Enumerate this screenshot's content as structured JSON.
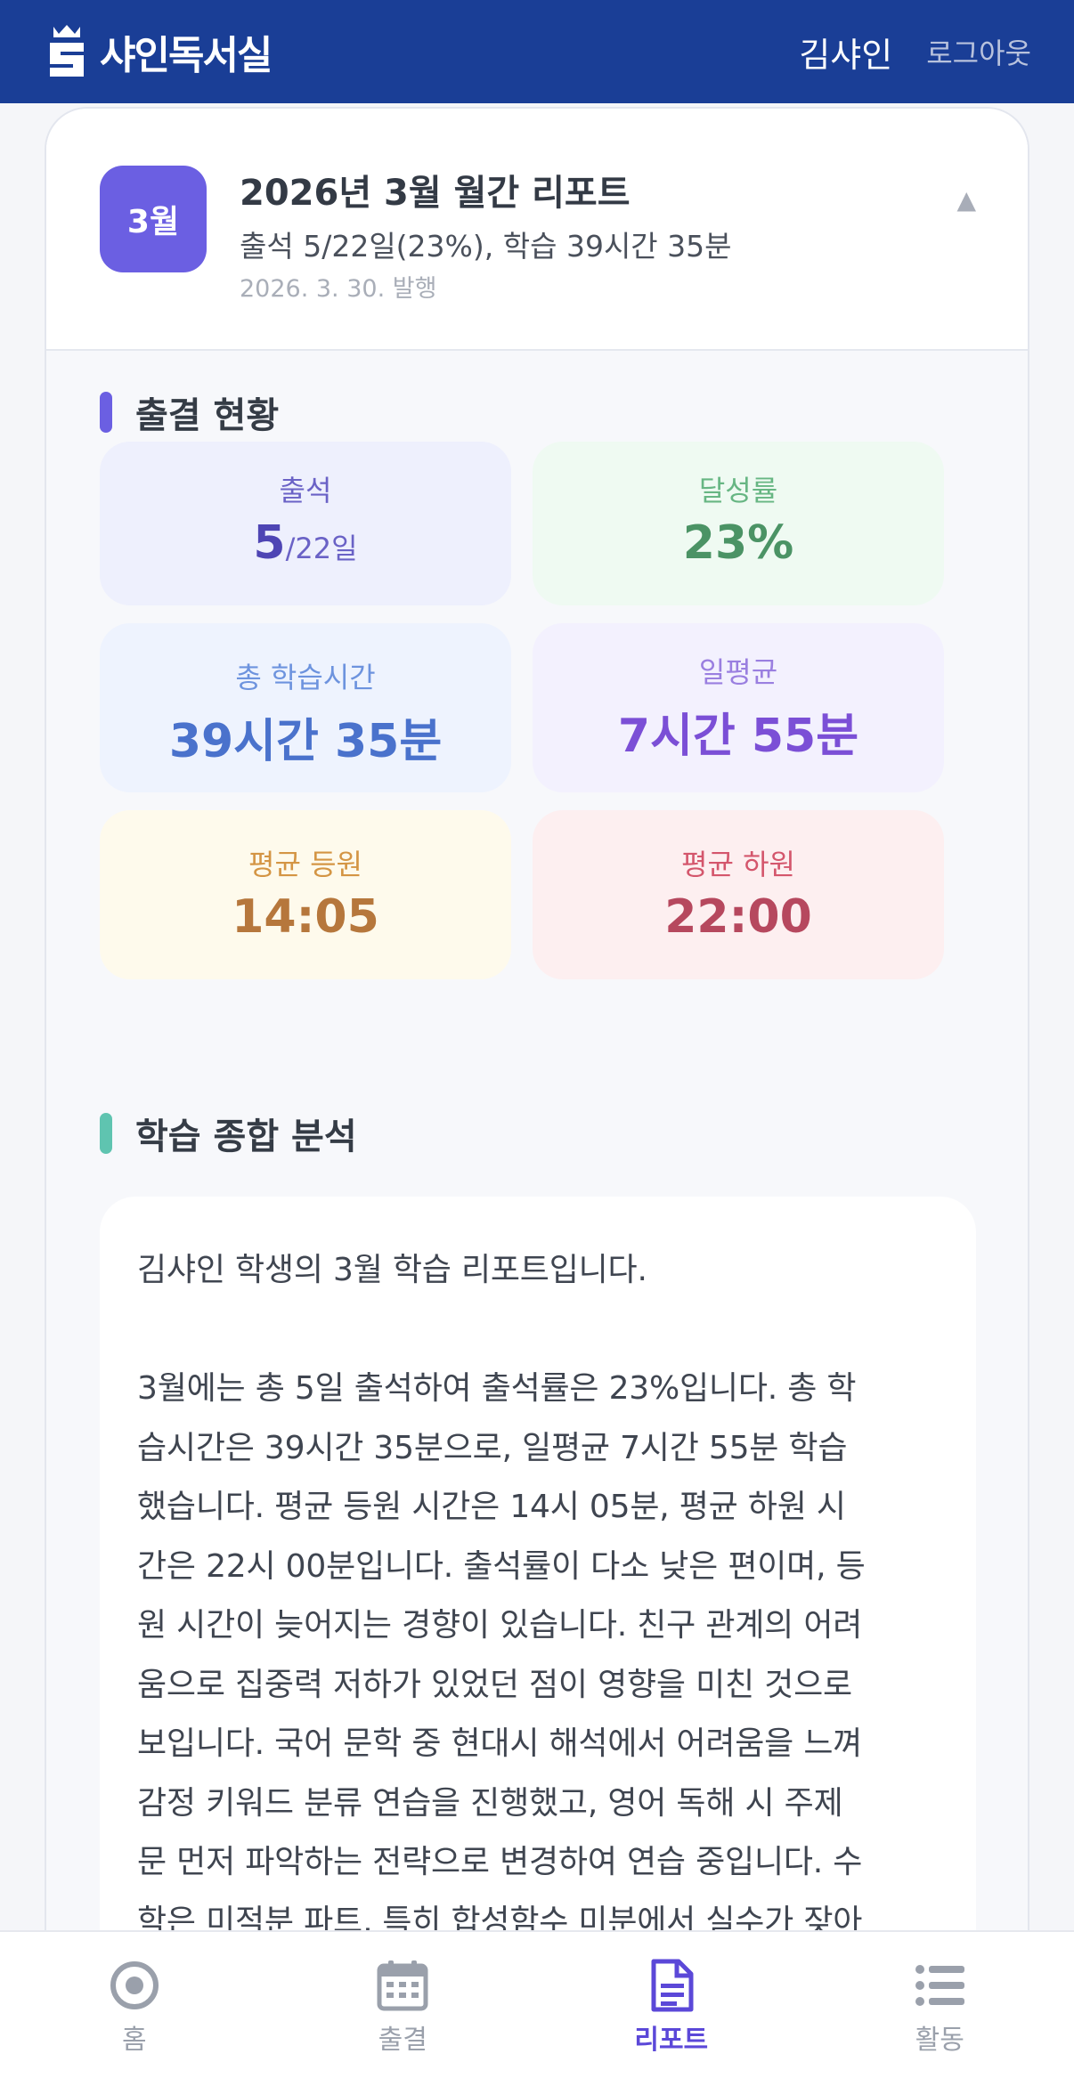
{
  "header": {
    "logo_text": "샤인독서실",
    "user_name": "김샤인",
    "logout_label": "로그아웃"
  },
  "report": {
    "month_badge": "3월",
    "title": "2026년 3월 월간 리포트",
    "summary": "출석 5/22일(23%), 학습 39시간 35분",
    "issued": "2026. 3. 30. 발행",
    "collapse_icon": "▲"
  },
  "attendance_section": {
    "title": "출결 현황",
    "stats": {
      "attendance": {
        "label": "출석",
        "value": "5",
        "suffix": "/22일"
      },
      "achievement": {
        "label": "달성률",
        "value": "23%"
      },
      "total_time": {
        "label": "총 학습시간",
        "value": "39시간 35분"
      },
      "daily_avg": {
        "label": "일평균",
        "value": "7시간 55분"
      },
      "avg_checkin": {
        "label": "평균 등원",
        "value": "14:05"
      },
      "avg_checkout": {
        "label": "평균 하원",
        "value": "22:00"
      }
    }
  },
  "analysis_section": {
    "title": "학습 종합 분석",
    "text": "김샤인 학생의 3월 학습 리포트입니다.\n\n3월에는 총 5일 출석하여 출석률은 23%입니다. 총 학\n습시간은 39시간 35분으로, 일평균 7시간 55분 학습\n했습니다. 평균 등원 시간은 14시 05분, 평균 하원 시\n간은 22시 00분입니다. 출석률이 다소 낮은 편이며, 등\n원 시간이 늦어지는 경향이 있습니다. 친구 관계의 어려\n움으로 집중력 저하가 있었던 점이 영향을 미친 것으로\n보입니다. 국어 문학 중 현대시 해석에서 어려움을 느껴\n감정 키워드 분류 연습을 진행했고, 영어 독해 시 주제\n문 먼저 파악하는 전략으로 변경하여 연습 중입니다. 수\n학은 미적분 파트, 특히 합성함수 미분에서 실수가 잦아"
  },
  "bottom_nav": {
    "items": [
      {
        "label": "홈",
        "icon": "home-icon"
      },
      {
        "label": "출결",
        "icon": "calendar-icon"
      },
      {
        "label": "리포트",
        "icon": "report-icon",
        "active": true
      },
      {
        "label": "활동",
        "icon": "list-icon"
      }
    ]
  },
  "colors": {
    "header_bg": "#1a3e96",
    "accent": "#5b48d8",
    "badge": "#6b5fe2"
  }
}
